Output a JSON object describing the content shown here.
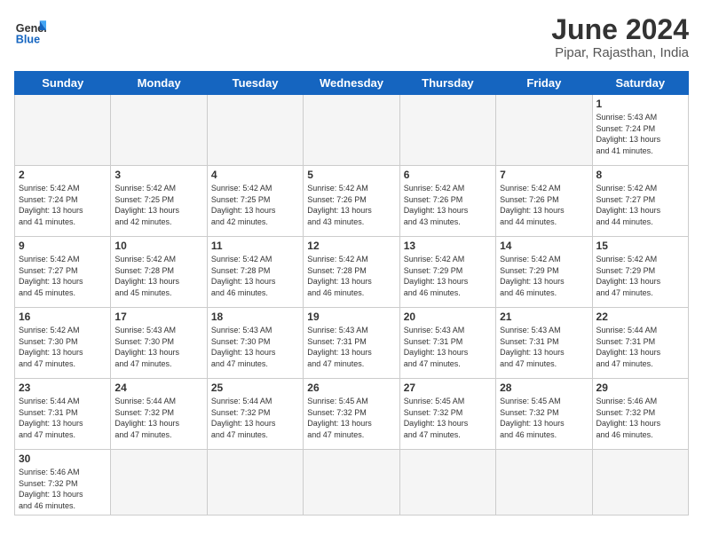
{
  "header": {
    "logo_general": "General",
    "logo_blue": "Blue",
    "title": "June 2024",
    "subtitle": "Pipar, Rajasthan, India"
  },
  "weekdays": [
    "Sunday",
    "Monday",
    "Tuesday",
    "Wednesday",
    "Thursday",
    "Friday",
    "Saturday"
  ],
  "weeks": [
    [
      {
        "day": "",
        "info": ""
      },
      {
        "day": "",
        "info": ""
      },
      {
        "day": "",
        "info": ""
      },
      {
        "day": "",
        "info": ""
      },
      {
        "day": "",
        "info": ""
      },
      {
        "day": "",
        "info": ""
      },
      {
        "day": "1",
        "info": "Sunrise: 5:43 AM\nSunset: 7:24 PM\nDaylight: 13 hours\nand 41 minutes."
      }
    ],
    [
      {
        "day": "2",
        "info": "Sunrise: 5:42 AM\nSunset: 7:24 PM\nDaylight: 13 hours\nand 41 minutes."
      },
      {
        "day": "3",
        "info": "Sunrise: 5:42 AM\nSunset: 7:25 PM\nDaylight: 13 hours\nand 42 minutes."
      },
      {
        "day": "4",
        "info": "Sunrise: 5:42 AM\nSunset: 7:25 PM\nDaylight: 13 hours\nand 42 minutes."
      },
      {
        "day": "5",
        "info": "Sunrise: 5:42 AM\nSunset: 7:26 PM\nDaylight: 13 hours\nand 43 minutes."
      },
      {
        "day": "6",
        "info": "Sunrise: 5:42 AM\nSunset: 7:26 PM\nDaylight: 13 hours\nand 43 minutes."
      },
      {
        "day": "7",
        "info": "Sunrise: 5:42 AM\nSunset: 7:26 PM\nDaylight: 13 hours\nand 44 minutes."
      },
      {
        "day": "8",
        "info": "Sunrise: 5:42 AM\nSunset: 7:27 PM\nDaylight: 13 hours\nand 44 minutes."
      }
    ],
    [
      {
        "day": "9",
        "info": "Sunrise: 5:42 AM\nSunset: 7:27 PM\nDaylight: 13 hours\nand 45 minutes."
      },
      {
        "day": "10",
        "info": "Sunrise: 5:42 AM\nSunset: 7:28 PM\nDaylight: 13 hours\nand 45 minutes."
      },
      {
        "day": "11",
        "info": "Sunrise: 5:42 AM\nSunset: 7:28 PM\nDaylight: 13 hours\nand 46 minutes."
      },
      {
        "day": "12",
        "info": "Sunrise: 5:42 AM\nSunset: 7:28 PM\nDaylight: 13 hours\nand 46 minutes."
      },
      {
        "day": "13",
        "info": "Sunrise: 5:42 AM\nSunset: 7:29 PM\nDaylight: 13 hours\nand 46 minutes."
      },
      {
        "day": "14",
        "info": "Sunrise: 5:42 AM\nSunset: 7:29 PM\nDaylight: 13 hours\nand 46 minutes."
      },
      {
        "day": "15",
        "info": "Sunrise: 5:42 AM\nSunset: 7:29 PM\nDaylight: 13 hours\nand 47 minutes."
      }
    ],
    [
      {
        "day": "16",
        "info": "Sunrise: 5:42 AM\nSunset: 7:30 PM\nDaylight: 13 hours\nand 47 minutes."
      },
      {
        "day": "17",
        "info": "Sunrise: 5:43 AM\nSunset: 7:30 PM\nDaylight: 13 hours\nand 47 minutes."
      },
      {
        "day": "18",
        "info": "Sunrise: 5:43 AM\nSunset: 7:30 PM\nDaylight: 13 hours\nand 47 minutes."
      },
      {
        "day": "19",
        "info": "Sunrise: 5:43 AM\nSunset: 7:31 PM\nDaylight: 13 hours\nand 47 minutes."
      },
      {
        "day": "20",
        "info": "Sunrise: 5:43 AM\nSunset: 7:31 PM\nDaylight: 13 hours\nand 47 minutes."
      },
      {
        "day": "21",
        "info": "Sunrise: 5:43 AM\nSunset: 7:31 PM\nDaylight: 13 hours\nand 47 minutes."
      },
      {
        "day": "22",
        "info": "Sunrise: 5:44 AM\nSunset: 7:31 PM\nDaylight: 13 hours\nand 47 minutes."
      }
    ],
    [
      {
        "day": "23",
        "info": "Sunrise: 5:44 AM\nSunset: 7:31 PM\nDaylight: 13 hours\nand 47 minutes."
      },
      {
        "day": "24",
        "info": "Sunrise: 5:44 AM\nSunset: 7:32 PM\nDaylight: 13 hours\nand 47 minutes."
      },
      {
        "day": "25",
        "info": "Sunrise: 5:44 AM\nSunset: 7:32 PM\nDaylight: 13 hours\nand 47 minutes."
      },
      {
        "day": "26",
        "info": "Sunrise: 5:45 AM\nSunset: 7:32 PM\nDaylight: 13 hours\nand 47 minutes."
      },
      {
        "day": "27",
        "info": "Sunrise: 5:45 AM\nSunset: 7:32 PM\nDaylight: 13 hours\nand 47 minutes."
      },
      {
        "day": "28",
        "info": "Sunrise: 5:45 AM\nSunset: 7:32 PM\nDaylight: 13 hours\nand 46 minutes."
      },
      {
        "day": "29",
        "info": "Sunrise: 5:46 AM\nSunset: 7:32 PM\nDaylight: 13 hours\nand 46 minutes."
      }
    ],
    [
      {
        "day": "30",
        "info": "Sunrise: 5:46 AM\nSunset: 7:32 PM\nDaylight: 13 hours\nand 46 minutes."
      },
      {
        "day": "",
        "info": ""
      },
      {
        "day": "",
        "info": ""
      },
      {
        "day": "",
        "info": ""
      },
      {
        "day": "",
        "info": ""
      },
      {
        "day": "",
        "info": ""
      },
      {
        "day": "",
        "info": ""
      }
    ]
  ]
}
